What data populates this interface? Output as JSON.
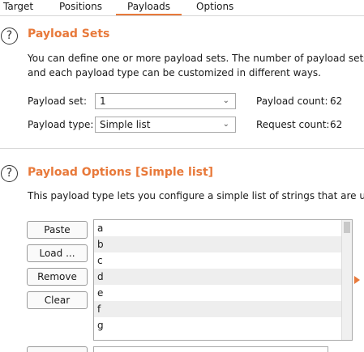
{
  "tabs": [
    {
      "label": "Target"
    },
    {
      "label": "Positions"
    },
    {
      "label": "Payloads"
    },
    {
      "label": "Options"
    }
  ],
  "payload_sets": {
    "help": "?",
    "title": "Payload Sets",
    "desc_line1": "You can define one or more payload sets. The number of payload sets",
    "desc_line2": "and each payload type can be customized in different ways.",
    "set_label": "Payload set:",
    "set_value": "1",
    "type_label": "Payload type:",
    "type_value": "Simple list",
    "payload_count_label": "Payload count:",
    "payload_count_value": "62",
    "request_count_label": "Request count:",
    "request_count_value": "62"
  },
  "payload_options": {
    "help": "?",
    "title": "Payload Options [Simple list]",
    "desc": "This payload type lets you configure a simple list of strings that are use",
    "buttons": {
      "paste": "Paste",
      "load": "Load ...",
      "remove": "Remove",
      "clear": "Clear"
    },
    "items": [
      "a",
      "b",
      "c",
      "d",
      "e",
      "f",
      "g"
    ]
  },
  "colors": {
    "accent": "#e8793a"
  }
}
